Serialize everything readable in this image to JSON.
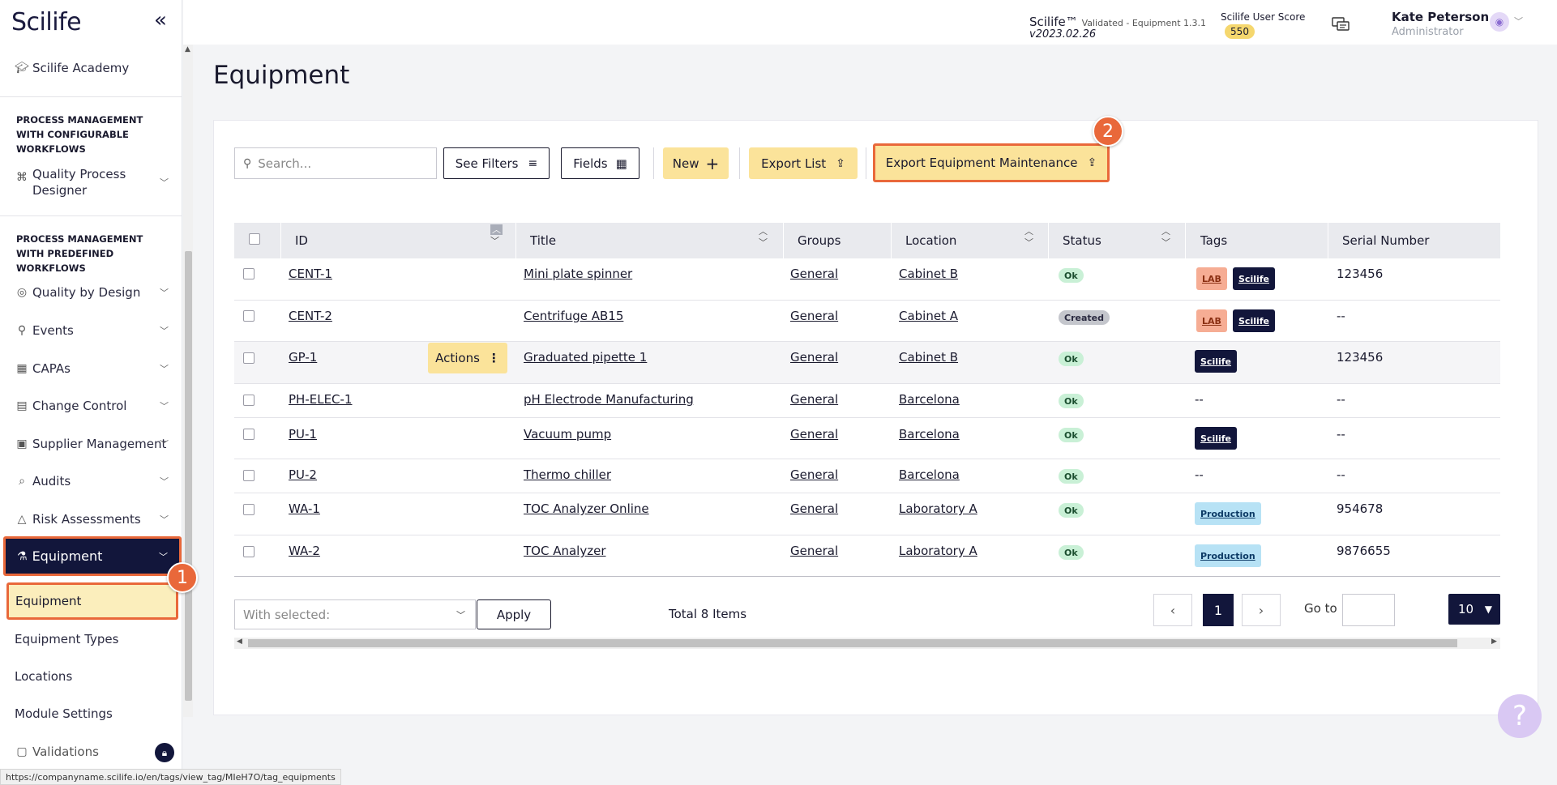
{
  "app": {
    "logo": "Scilife",
    "product_name": "Scilife™",
    "product_status": "Validated - Equipment 1.3.1",
    "version": "v2023.02.26",
    "score_label": "Scilife User Score",
    "score_value": "550",
    "user_name": "Kate Peterson",
    "user_role": "Administrator"
  },
  "sidebar": {
    "academy": "Scilife Academy",
    "section_configurable": "PROCESS MANAGEMENT WITH CONFIGURABLE WORKFLOWS",
    "quality_process_designer": "Quality Process Designer",
    "section_predefined": "PROCESS MANAGEMENT WITH PREDEFINED WORKFLOWS",
    "items": [
      {
        "label": "Quality by Design",
        "icon": "design-icon"
      },
      {
        "label": "Events",
        "icon": "pin-icon"
      },
      {
        "label": "CAPAs",
        "icon": "capa-icon"
      },
      {
        "label": "Change Control",
        "icon": "change-icon"
      },
      {
        "label": "Supplier Management",
        "icon": "supplier-icon"
      },
      {
        "label": "Audits",
        "icon": "audit-icon"
      },
      {
        "label": "Risk Assessments",
        "icon": "warning-icon"
      }
    ],
    "equipment": "Equipment",
    "equipment_sub": [
      "Equipment",
      "Equipment Types",
      "Locations",
      "Module Settings"
    ],
    "validations": "Validations"
  },
  "status_url": "https://companyname.scilife.io/en/tags/view_tag/MIeH7O/tag_equipments",
  "main": {
    "title": "Equipment",
    "search_placeholder": "Search...",
    "see_filters": "See Filters",
    "fields": "Fields",
    "new": "New",
    "export_list": "Export List",
    "export_maintenance": "Export Equipment Maintenance",
    "actions": "Actions"
  },
  "annotations": {
    "step1": "1",
    "step2": "2"
  },
  "table": {
    "headers": [
      "ID",
      "Title",
      "Groups",
      "Location",
      "Status",
      "Tags",
      "Serial Number"
    ],
    "rows": [
      {
        "id": "CENT-1",
        "title": "Mini plate spinner",
        "group": "General",
        "location": "Cabinet B",
        "status": "Ok",
        "tags": [
          "LAB",
          "Scilife"
        ],
        "serial": "123456"
      },
      {
        "id": "CENT-2",
        "title": "Centrifuge AB15",
        "group": "General",
        "location": "Cabinet A",
        "status": "Created",
        "tags": [
          "LAB",
          "Scilife"
        ],
        "serial": "--"
      },
      {
        "id": "GP-1",
        "title": "Graduated pipette 1",
        "group": "General",
        "location": "Cabinet B",
        "status": "Ok",
        "tags": [
          "Scilife"
        ],
        "serial": "123456"
      },
      {
        "id": "PH-ELEC-1",
        "title": "pH Electrode Manufacturing",
        "group": "General",
        "location": "Barcelona",
        "status": "Ok",
        "tags_text": "--",
        "serial": "--"
      },
      {
        "id": "PU-1",
        "title": "Vacuum pump",
        "group": "General",
        "location": "Barcelona",
        "status": "Ok",
        "tags": [
          "Scilife"
        ],
        "serial": "--"
      },
      {
        "id": "PU-2",
        "title": "Thermo chiller",
        "group": "General",
        "location": "Barcelona",
        "status": "Ok",
        "tags_text": "--",
        "serial": "--"
      },
      {
        "id": "WA-1",
        "title": "TOC Analyzer Online",
        "group": "General",
        "location": "Laboratory A",
        "status": "Ok",
        "tags": [
          "Production"
        ],
        "serial": "954678"
      },
      {
        "id": "WA-2",
        "title": "TOC Analyzer",
        "group": "General",
        "location": "Laboratory A",
        "status": "Ok",
        "tags": [
          "Production"
        ],
        "serial": "9876655"
      }
    ]
  },
  "footer": {
    "with_selected": "With selected:",
    "apply": "Apply",
    "total": "Total 8 Items",
    "prev": "‹",
    "current_page": "1",
    "next": "›",
    "goto": "Go to",
    "page_size": "10"
  },
  "colors": {
    "navy": "#12163b",
    "yellow": "#fbe39a",
    "highlight_orange": "#e9683a"
  }
}
